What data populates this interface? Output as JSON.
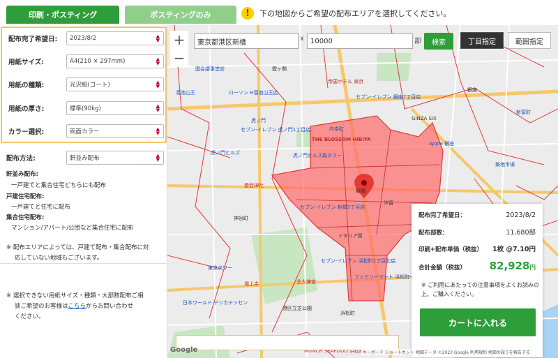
{
  "tabs": {
    "print_label": "印刷・ポスティング",
    "posting_label": "ポスティングのみ"
  },
  "notice": {
    "icon_text": "!",
    "text": "下の地図からご希望の配布エリアを選択してください。"
  },
  "form": {
    "fields": [
      {
        "label": "配布完了希望日:",
        "value": "2023/8/2"
      },
      {
        "label": "用紙サイズ:",
        "value": "A4(210 × 297mm)"
      },
      {
        "label": "用紙の種類:",
        "value": "光沢紙(コート)"
      },
      {
        "label": "用紙の厚さ:",
        "value": "標準(90kg)"
      },
      {
        "label": "カラー選択:",
        "value": "両面カラー"
      }
    ],
    "method": {
      "label": "配布方法:",
      "value": "軒並み配布"
    }
  },
  "descriptions": {
    "nokinami_title": "軒並み配布:",
    "nokinami_text": "一戸建てと集合住宅どちらにも配布",
    "kodate_title": "戸建住宅配布:",
    "kodate_text": "一戸建てと住宅に配布",
    "shugo_title": "集合住宅配布:",
    "shugo_text": "マンション/アパート/公団など集合住宅に配布",
    "note1_line1": "※ 配布エリアによっては、戸建て配布・集合配布に対",
    "note1_line2": "応していない地域もございます。",
    "note2_line1": "※ 選択できない用紙サイズ・種類・大部数配布ご相",
    "note2_pre": "談ご希望のお客様は",
    "note2_link": "こちら",
    "note2_post": "からお問い合わせ",
    "note2_line3": "ください。"
  },
  "map": {
    "zoom_in": "+",
    "zoom_out": "−",
    "address_value": "東京都港区新橋",
    "multiplier": "x",
    "quantity_value": "10000",
    "unit": "部",
    "search_label": "検索",
    "chome_label": "丁目指定",
    "range_label": "範囲指定",
    "google_label": "Google",
    "attribution": "キーボード ショートカット   地図データ ©2023 Google   利用規約   地図の誤りを報告する",
    "labels": [
      "国会議事堂前",
      "溜池山王",
      "ローソン H溜池山王店",
      "虎ノ門",
      "セブン-イレブン 虎ノ門1丁目店",
      "虎ノ門ヒルズ",
      "虎ノ門ヒルズ森タワー",
      "THE BLOSSOM HIBIYA",
      "内幸町",
      "帝国ホテル 東京",
      "セブン-イレブン 銀座7丁目店",
      "GINZA SIX",
      "Apple 銀座",
      "新橋",
      "愛宕神社",
      "セブン-イレブン 新橋5丁目店",
      "イタリア街",
      "セブン-イレブン 浜松町1丁目北店",
      "芝大神宮",
      "東京タワー",
      "増上寺",
      "日本ワールド デリカテッセン",
      "港区立芝公園",
      "MUNCH SEAFOOD 浜松町",
      "ファミリーマート 浜松町一丁目店",
      "浜松町",
      "神谷町",
      "霞ヶ関",
      "銀座",
      "汐留",
      "築地市場",
      "新富町"
    ]
  },
  "summary": {
    "date_label": "配布完了希望日：",
    "date_value": "2023/8/2",
    "count_label": "配布部数：",
    "count_value": "11,680部",
    "unit_price_label": "印刷+配布単価（税抜）",
    "unit_price_value": "1枚 @7.10円",
    "total_label": "合計金額（税抜）",
    "total_value": "82,928",
    "total_unit": "円",
    "note": "※ ご利用にあたっての注意事項をよくお読みの上、ご購入ください。",
    "cart_label": "カートに入れる"
  },
  "colors": {
    "brand_green": "#2e9e3a",
    "tab_light_green": "#8fcf8a",
    "highlight_orange": "#f4c46a",
    "area_red": "#ff6b6b"
  }
}
